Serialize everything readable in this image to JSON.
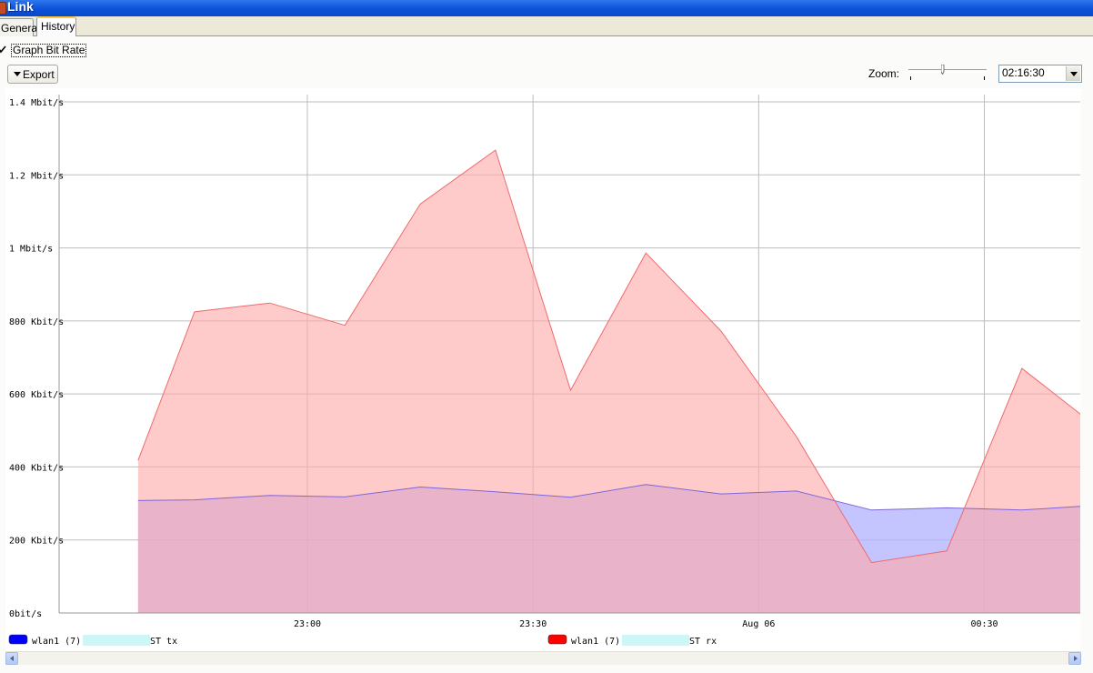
{
  "window": {
    "title": "Link"
  },
  "tabs": [
    {
      "label": "General"
    },
    {
      "label": "History"
    }
  ],
  "graph_bit_rate": {
    "label": "Graph Bit Rate",
    "checked": true
  },
  "export": {
    "label": "Export"
  },
  "zoom": {
    "label": "Zoom:",
    "value": "02:16:30",
    "slider_fraction": 0.44
  },
  "colors": {
    "tx_line": "#7e66d8",
    "tx_fill": "#b0b0ff",
    "rx_line": "#f06a6a",
    "rx_fill": "#ffaaaa",
    "grid": "#bdbdbd"
  },
  "chart_data": {
    "type": "area",
    "yticks": [
      {
        "v": 0,
        "label": "0bit/s"
      },
      {
        "v": 200,
        "label": "200 Kbit/s"
      },
      {
        "v": 400,
        "label": "400 Kbit/s"
      },
      {
        "v": 600,
        "label": "600 Kbit/s"
      },
      {
        "v": 800,
        "label": "800 Kbit/s"
      },
      {
        "v": 1000,
        "label": "1 Mbit/s"
      },
      {
        "v": 1200,
        "label": "1.2 Mbit/s"
      },
      {
        "v": 1400,
        "label": "1.4 Mbit/s"
      }
    ],
    "ylim": [
      0,
      1420
    ],
    "xlim": [
      -22,
      68.5
    ],
    "xticks": [
      {
        "x": 0,
        "label": "23:00"
      },
      {
        "x": 20,
        "label": "23:30"
      },
      {
        "x": 40,
        "label": "Aug 06"
      },
      {
        "x": 60,
        "label": "00:30"
      }
    ],
    "x": [
      -15,
      -10,
      -3.33,
      3.33,
      10,
      16.67,
      23.33,
      30,
      36.67,
      43.33,
      50,
      56.67,
      63.33,
      68.5
    ],
    "series": [
      {
        "name": "wlan1 (7) @ ST tx",
        "color": "#0000ff",
        "values": [
          308,
          310,
          322,
          318,
          345,
          332,
          317,
          352,
          326,
          334,
          282,
          288,
          282,
          292
        ]
      },
      {
        "name": "wlan1 (7) @ ST rx",
        "color": "#ff0000",
        "values": [
          418,
          825,
          849,
          788,
          1120,
          1268,
          610,
          986,
          772,
          484,
          138,
          170,
          670,
          545
        ]
      }
    ],
    "extra_tx_x": 68.5,
    "extra_tx_value": 318,
    "grid": true,
    "legend": "bottom"
  }
}
